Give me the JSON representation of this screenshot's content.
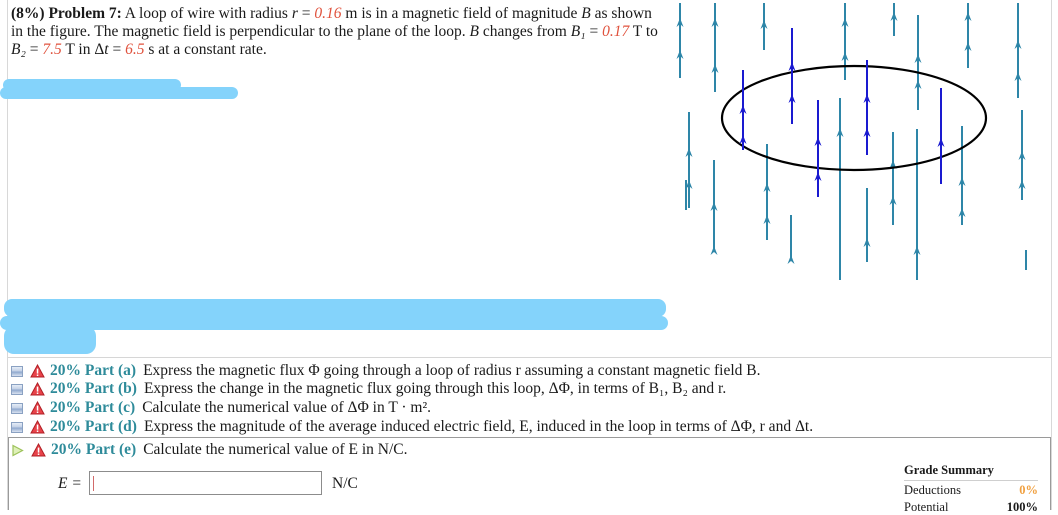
{
  "problem": {
    "weight": "(8%)",
    "title": "Problem 7:",
    "segments": [
      {
        "t": "text",
        "v": "  A loop of wire with radius "
      },
      {
        "t": "var",
        "v": "r"
      },
      {
        "t": "text",
        "v": " = "
      },
      {
        "t": "val",
        "v": "0.16"
      },
      {
        "t": "text",
        "v": " m is in a magnetic field of magnitude "
      },
      {
        "t": "var",
        "v": "B"
      },
      {
        "t": "text",
        "v": " as shown in the figure. The magnetic field is perpendicular to the plane of the loop. "
      },
      {
        "t": "var",
        "v": "B"
      },
      {
        "t": "text",
        "v": " changes from "
      },
      {
        "t": "var",
        "v": "B₁"
      },
      {
        "t": "text",
        "v": " = "
      },
      {
        "t": "val",
        "v": "0.17"
      },
      {
        "t": "text",
        "v": " T to "
      },
      {
        "t": "var",
        "v": "B₂"
      },
      {
        "t": "text",
        "v": " = "
      },
      {
        "t": "val",
        "v": "7.5"
      },
      {
        "t": "text",
        "v": " T in Δ"
      },
      {
        "t": "var",
        "v": "t"
      },
      {
        "t": "text",
        "v": " = "
      },
      {
        "t": "val",
        "v": "6.5"
      },
      {
        "t": "text",
        "v": " s at a constant rate."
      }
    ]
  },
  "figure": {
    "description": "Loop of wire in a vertical upward magnetic field",
    "colors": {
      "field_outside": "#2e86a8",
      "field_inside": "#1a1ad0",
      "loop": "#000000"
    }
  },
  "redaction_color": "#84d3fb",
  "parts": [
    {
      "status_icon": "collapsed-square-icon",
      "warn_icon": "warning-triangle-icon",
      "percent": "20%",
      "label": "Part (a)",
      "desc": "Express the magnetic flux Φ going through a loop of radius r assuming a constant magnetic field B."
    },
    {
      "status_icon": "collapsed-square-icon",
      "warn_icon": "warning-triangle-icon",
      "percent": "20%",
      "label": "Part (b)",
      "desc": "Express the change in the magnetic flux going through this loop, ΔΦ, in terms of B₁, B₂ and r."
    },
    {
      "status_icon": "collapsed-square-icon",
      "warn_icon": "warning-triangle-icon",
      "percent": "20%",
      "label": "Part (c)",
      "desc": "Calculate the numerical value of ΔΦ in T · m²."
    },
    {
      "status_icon": "collapsed-square-icon",
      "warn_icon": "warning-triangle-icon",
      "percent": "20%",
      "label": "Part (d)",
      "desc": "Express the magnitude of the average induced electric field, E, induced in the loop in terms of ΔΦ, r and Δt."
    },
    {
      "status_icon": "play-triangle-icon",
      "warn_icon": "warning-triangle-icon",
      "percent": "20%",
      "label": "Part (e)",
      "desc": "Calculate the numerical value of E in N/C."
    }
  ],
  "answer": {
    "label": "E =",
    "value": "",
    "unit": "N/C"
  },
  "grade_summary": {
    "title": "Grade Summary",
    "deductions_label": "Deductions",
    "deductions_value": "0%",
    "potential_label": "Potential",
    "potential_value": "100%"
  }
}
